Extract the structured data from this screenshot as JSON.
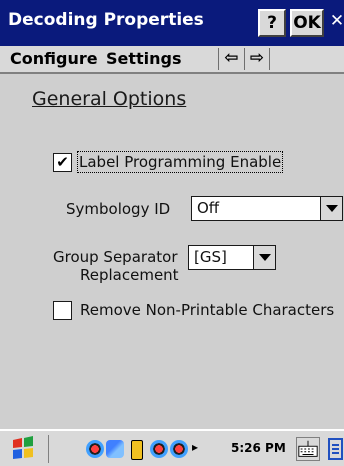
{
  "window": {
    "title": "Decoding Properties",
    "help_label": "?",
    "ok_label": "OK",
    "close_label": "✕"
  },
  "menubar": {
    "configure": "Configure",
    "settings": "Settings",
    "back_arrow": "⇦",
    "forward_arrow": "⇨"
  },
  "page": {
    "heading": "General Options",
    "label_programming": {
      "label": "Label Programming Enable",
      "checked": true,
      "mark": "✔"
    },
    "symbology_id": {
      "label": "Symbology ID",
      "value": "Off"
    },
    "group_separator": {
      "label_line1": "Group Separator",
      "label_line2": "Replacement",
      "value": "[GS]"
    },
    "remove_non_printable": {
      "label": "Remove Non-Printable Characters",
      "checked": false
    }
  },
  "taskbar": {
    "time": "5:26 PM",
    "tray_arrow": "▸"
  },
  "colors": {
    "titlebar": "#0a1a7c",
    "background": "#cfcfcf",
    "control_face": "#d9d9d9"
  }
}
